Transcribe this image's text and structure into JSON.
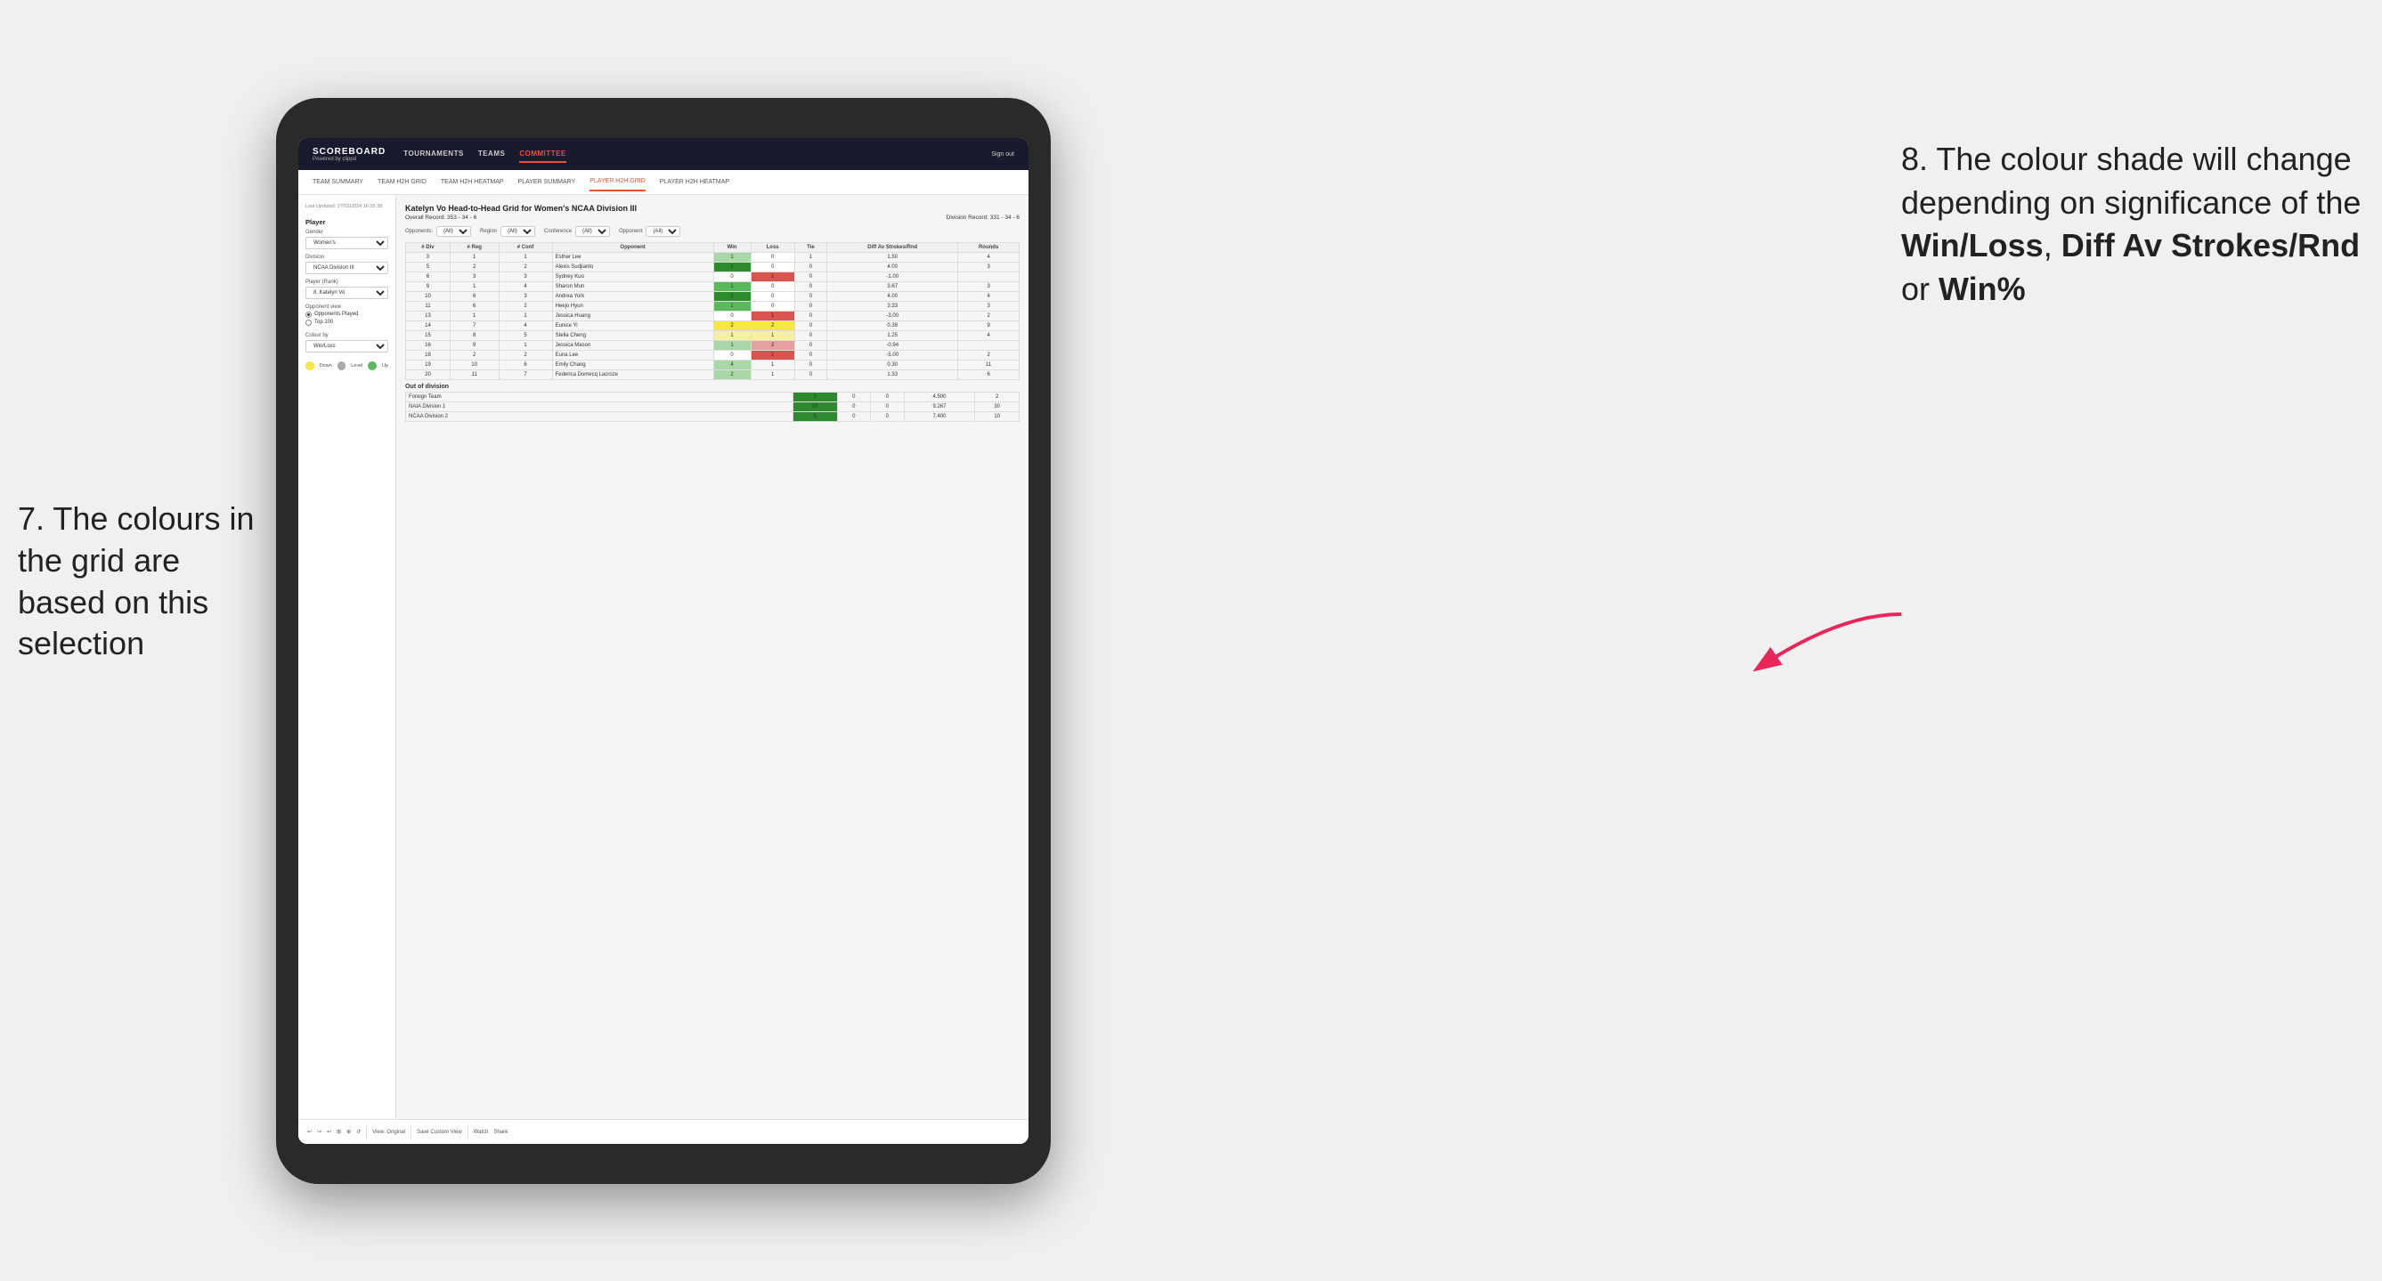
{
  "page": {
    "bg_color": "#f0f0f0"
  },
  "annotation_left": {
    "number": "7.",
    "text": "The colours in the grid are based on this selection"
  },
  "annotation_right": {
    "number": "8.",
    "text1": "The colour shade will change depending on significance of the ",
    "bold1": "Win/Loss",
    "text2": ", ",
    "bold2": "Diff Av Strokes/Rnd",
    "text3": " or ",
    "bold3": "Win%"
  },
  "nav": {
    "logo": "SCOREBOARD",
    "powered_by": "Powered by clippd",
    "items": [
      "TOURNAMENTS",
      "TEAMS",
      "COMMITTEE"
    ],
    "active_item": "COMMITTEE",
    "sign_in": "Sign out"
  },
  "sub_nav": {
    "items": [
      "TEAM SUMMARY",
      "TEAM H2H GRID",
      "TEAM H2H HEATMAP",
      "PLAYER SUMMARY",
      "PLAYER H2H GRID",
      "PLAYER H2H HEATMAP"
    ],
    "active_item": "PLAYER H2H GRID"
  },
  "sidebar": {
    "last_updated_label": "Last Updated: 27/03/2024 16:55:38",
    "player_section": "Player",
    "gender_label": "Gender",
    "gender_value": "Women's",
    "division_label": "Division",
    "division_value": "NCAA Division III",
    "player_rank_label": "Player (Rank)",
    "player_rank_value": "8. Katelyn Vo",
    "opponent_view_label": "Opponent view",
    "opponent_options": [
      "Opponents Played",
      "Top 100"
    ],
    "colour_by_label": "Colour by",
    "colour_by_value": "Win/Loss",
    "legend": {
      "down": "Down",
      "level": "Level",
      "up": "Up"
    }
  },
  "grid": {
    "title": "Katelyn Vo Head-to-Head Grid for Women's NCAA Division III",
    "overall_record": "Overall Record: 353 - 34 - 6",
    "division_record": "Division Record: 331 - 34 - 6",
    "filters": {
      "opponents_label": "Opponents:",
      "region_label": "Region",
      "conference_label": "Conference",
      "opponent_label": "Opponent",
      "all_value": "(All)"
    },
    "table_headers": [
      "# Div",
      "# Reg",
      "# Conf",
      "Opponent",
      "Win",
      "Loss",
      "Tie",
      "Diff Av Strokes/Rnd",
      "Rounds"
    ],
    "rows": [
      {
        "div": "3",
        "reg": "1",
        "conf": "1",
        "name": "Esther Lee",
        "win": "1",
        "loss": "0",
        "tie": "1",
        "diff": "1.50",
        "rounds": "4",
        "win_class": "cell-win-light",
        "loss_class": "cell-neutral"
      },
      {
        "div": "5",
        "reg": "2",
        "conf": "2",
        "name": "Alexis Sudjianto",
        "win": "1",
        "loss": "0",
        "tie": "0",
        "diff": "4.00",
        "rounds": "3",
        "win_class": "cell-win-strong",
        "loss_class": "cell-neutral"
      },
      {
        "div": "6",
        "reg": "3",
        "conf": "3",
        "name": "Sydney Kuo",
        "win": "0",
        "loss": "1",
        "tie": "0",
        "diff": "-1.00",
        "rounds": "",
        "win_class": "cell-neutral",
        "loss_class": "cell-loss-strong"
      },
      {
        "div": "9",
        "reg": "1",
        "conf": "4",
        "name": "Sharon Mun",
        "win": "1",
        "loss": "0",
        "tie": "0",
        "diff": "3.67",
        "rounds": "3",
        "win_class": "cell-win-med",
        "loss_class": "cell-neutral"
      },
      {
        "div": "10",
        "reg": "6",
        "conf": "3",
        "name": "Andrea York",
        "win": "2",
        "loss": "0",
        "tie": "0",
        "diff": "4.00",
        "rounds": "4",
        "win_class": "cell-win-strong",
        "loss_class": "cell-neutral"
      },
      {
        "div": "11",
        "reg": "6",
        "conf": "2",
        "name": "Heejo Hyun",
        "win": "1",
        "loss": "0",
        "tie": "0",
        "diff": "3.33",
        "rounds": "3",
        "win_class": "cell-win-med",
        "loss_class": "cell-neutral"
      },
      {
        "div": "13",
        "reg": "1",
        "conf": "1",
        "name": "Jessica Huang",
        "win": "0",
        "loss": "1",
        "tie": "0",
        "diff": "-3.00",
        "rounds": "2",
        "win_class": "cell-neutral",
        "loss_class": "cell-loss-strong"
      },
      {
        "div": "14",
        "reg": "7",
        "conf": "4",
        "name": "Eunice Yi",
        "win": "2",
        "loss": "2",
        "tie": "0",
        "diff": "0.38",
        "rounds": "9",
        "win_class": "cell-yellow",
        "loss_class": "cell-yellow"
      },
      {
        "div": "15",
        "reg": "8",
        "conf": "5",
        "name": "Stella Cheng",
        "win": "1",
        "loss": "1",
        "tie": "0",
        "diff": "1.25",
        "rounds": "4",
        "win_class": "cell-yellow-light",
        "loss_class": "cell-yellow-light"
      },
      {
        "div": "16",
        "reg": "9",
        "conf": "1",
        "name": "Jessica Mason",
        "win": "1",
        "loss": "2",
        "tie": "0",
        "diff": "-0.94",
        "rounds": "",
        "win_class": "cell-win-light",
        "loss_class": "cell-loss-med"
      },
      {
        "div": "18",
        "reg": "2",
        "conf": "2",
        "name": "Euna Lee",
        "win": "0",
        "loss": "1",
        "tie": "0",
        "diff": "-5.00",
        "rounds": "2",
        "win_class": "cell-neutral",
        "loss_class": "cell-loss-strong"
      },
      {
        "div": "19",
        "reg": "10",
        "conf": "6",
        "name": "Emily Chang",
        "win": "4",
        "loss": "1",
        "tie": "0",
        "diff": "0.30",
        "rounds": "11",
        "win_class": "cell-win-light",
        "loss_class": "cell-loss-light"
      },
      {
        "div": "20",
        "reg": "11",
        "conf": "7",
        "name": "Federica Domecq Lacroze",
        "win": "2",
        "loss": "1",
        "tie": "0",
        "diff": "1.33",
        "rounds": "6",
        "win_class": "cell-win-light",
        "loss_class": "cell-loss-light"
      }
    ],
    "out_of_division": {
      "label": "Out of division",
      "rows": [
        {
          "name": "Foreign Team",
          "win": "1",
          "loss": "0",
          "tie": "0",
          "diff": "4.500",
          "rounds": "2",
          "win_class": "cell-win-strong"
        },
        {
          "name": "NAIA Division 1",
          "win": "15",
          "loss": "0",
          "tie": "0",
          "diff": "9.267",
          "rounds": "30",
          "win_class": "cell-win-strong"
        },
        {
          "name": "NCAA Division 2",
          "win": "5",
          "loss": "0",
          "tie": "0",
          "diff": "7.400",
          "rounds": "10",
          "win_class": "cell-win-strong"
        }
      ]
    }
  },
  "toolbar": {
    "view_original": "View: Original",
    "save_custom": "Save Custom View",
    "watch": "Watch",
    "share": "Share"
  }
}
